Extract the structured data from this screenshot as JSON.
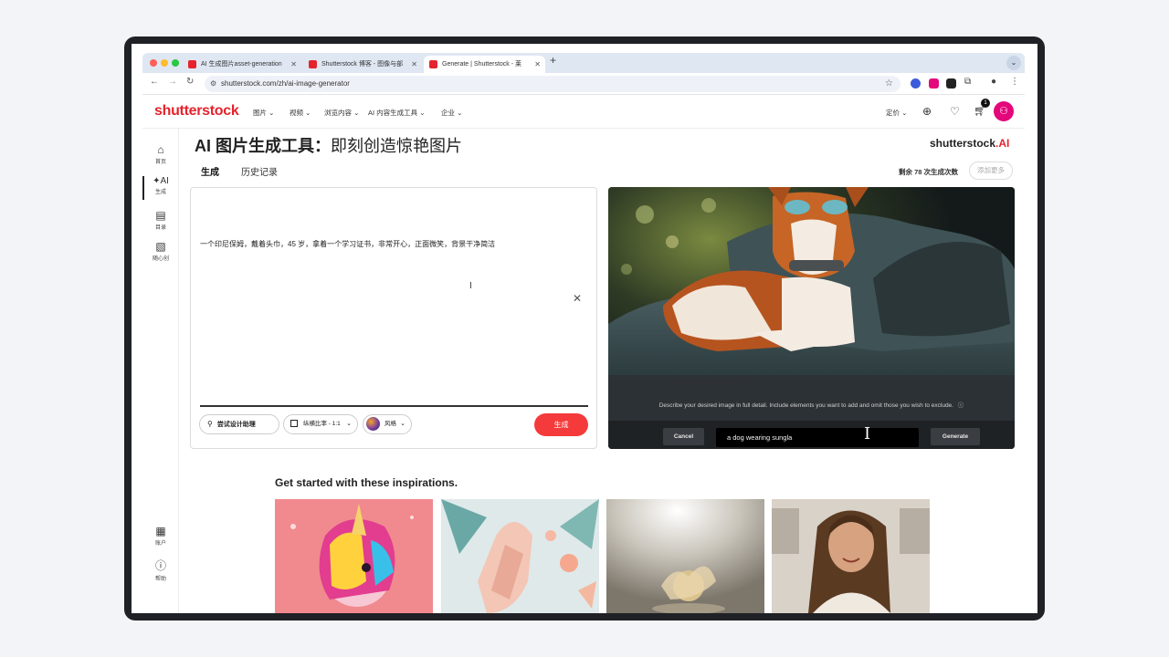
{
  "browser": {
    "tabs": [
      {
        "title": "AI 生成图片asset-generation"
      },
      {
        "title": "Shutterstock 博客 - 图像与部"
      },
      {
        "title": "Generate | Shutterstock - 莱"
      }
    ],
    "new_tab": "+",
    "url": "shutterstock.com/zh/ai-image-generator"
  },
  "site": {
    "logo": "shutterstock",
    "nav": [
      "图片 ⌄",
      "视频 ⌄",
      "浏览内容 ⌄",
      "AI 内容生成工具 ⌄",
      "企业 ⌄"
    ],
    "pricing": "定价 ⌄",
    "cart_count": "1"
  },
  "rail": {
    "home": "首页",
    "generate": "生成",
    "catalog": "目录",
    "create": "随心创",
    "account": "账户",
    "help": "帮助",
    "generate_icon": "✦AI"
  },
  "main": {
    "title_bold": "AI 图片生成工具：",
    "title_rest": "即刻创造惊艳图片",
    "brand": "shutterstock",
    "brand_mark": ".AI",
    "tabs": [
      "生成",
      "历史记录"
    ],
    "credits": "剩余 78 次生成次数",
    "add_more": "添加更多"
  },
  "prompt": {
    "text": "一个印尼保姆，戴着头巾，45 岁，拿着一个学习证书，非常开心，正面微笑，背景干净简洁",
    "assistant_btn": "尝试设计助理",
    "aspect_label": "纵横比率 - 1:1",
    "style_label": "风格",
    "generate_btn": "生成"
  },
  "editor": {
    "hint": "Describe your desired image in full detail. Include elements you want to add and omit those you wish to exclude.",
    "cancel": "Cancel",
    "input_value": "a dog wearing sungla",
    "generate": "Generate"
  },
  "inspirations": {
    "title": "Get started with these inspirations."
  },
  "colors": {
    "brand_red": "#e4232c",
    "avatar_pink": "#e4067b",
    "generate_red": "#f43a3a"
  }
}
